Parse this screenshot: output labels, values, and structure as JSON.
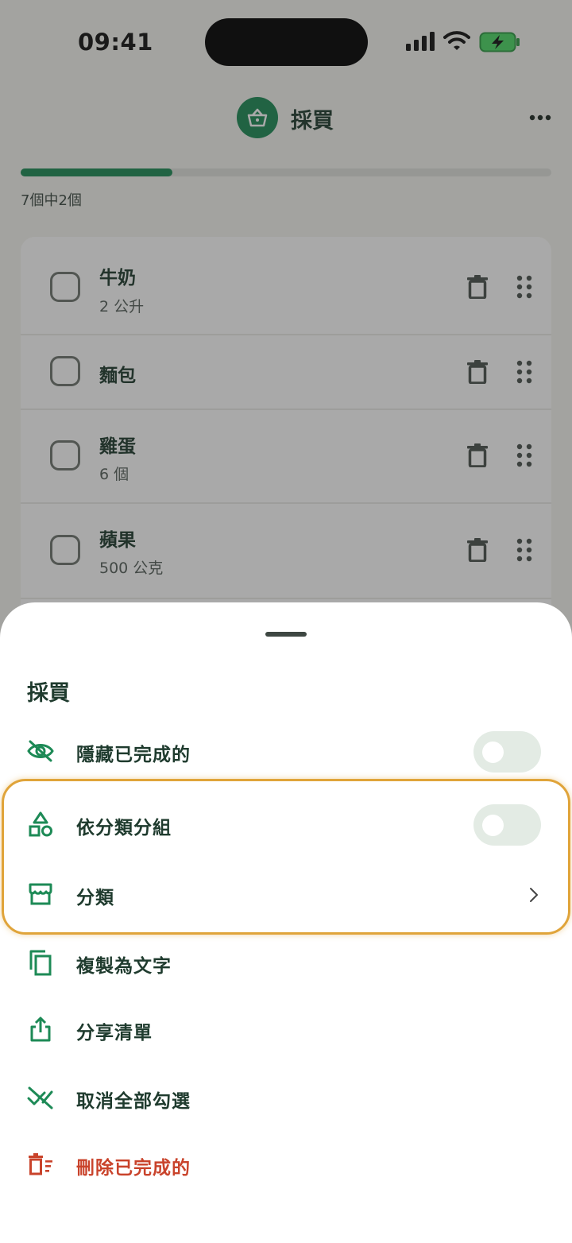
{
  "status_bar": {
    "time": "09:41"
  },
  "header": {
    "title": "採買",
    "logo_icon": "basket-icon",
    "more_icon": "more-horizontal-icon"
  },
  "progress": {
    "text": "7個中2個",
    "completed": 2,
    "total": 7,
    "fraction": 0.2857,
    "color": "#1d8a56"
  },
  "items": [
    {
      "name": "牛奶",
      "quantity": "2 公升"
    },
    {
      "name": "麵包",
      "quantity": ""
    },
    {
      "name": "雞蛋",
      "quantity": "6 個"
    },
    {
      "name": "蘋果",
      "quantity": "500 公克"
    }
  ],
  "sheet": {
    "title": "採買",
    "options": [
      {
        "label": "隱藏已完成的",
        "icon": "eye-off-icon",
        "control": "toggle",
        "on": false
      },
      {
        "label": "依分類分組",
        "icon": "shapes-icon",
        "control": "toggle",
        "on": false
      },
      {
        "label": "分類",
        "icon": "store-icon",
        "control": "chevron"
      },
      {
        "label": "複製為文字",
        "icon": "copy-icon"
      },
      {
        "label": "分享清單",
        "icon": "share-icon"
      },
      {
        "label": "取消全部勾選",
        "icon": "uncheck-all-icon"
      },
      {
        "label": "刪除已完成的",
        "icon": "delete-completed-icon",
        "danger": true
      }
    ]
  },
  "colors": {
    "accent": "#1d8a56",
    "text": "#1f3b2e",
    "danger": "#c9432b",
    "highlight": "#e0a43a"
  }
}
